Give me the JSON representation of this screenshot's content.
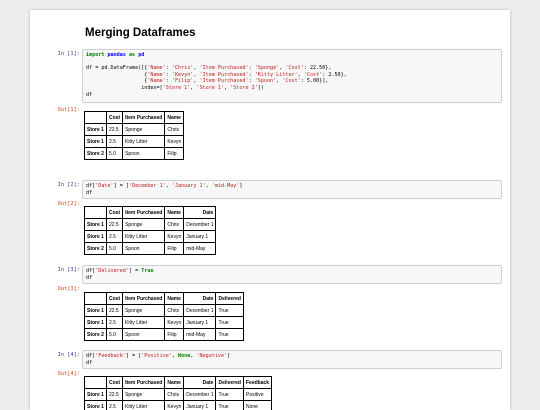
{
  "notebook": {
    "title": "Merging Dataframes",
    "cells": [
      {
        "in_prompt": "In [1]:",
        "out_prompt": "Out[1]:",
        "code_lines": [
          [
            {
              "t": "import",
              "c": "kw"
            },
            {
              "t": " "
            },
            {
              "t": "pandas",
              "c": "nm"
            },
            {
              "t": " "
            },
            {
              "t": "as",
              "c": "kw"
            },
            {
              "t": " "
            },
            {
              "t": "pd",
              "c": "nm"
            }
          ],
          [
            {
              "t": ""
            }
          ],
          [
            {
              "t": "df = pd.DataFrame([{"
            },
            {
              "t": "'Name'",
              "c": "str"
            },
            {
              "t": ": "
            },
            {
              "t": "'Chris'",
              "c": "str"
            },
            {
              "t": ", "
            },
            {
              "t": "'Item Purchased'",
              "c": "str"
            },
            {
              "t": ": "
            },
            {
              "t": "'Sponge'",
              "c": "str"
            },
            {
              "t": ", "
            },
            {
              "t": "'Cost'",
              "c": "str"
            },
            {
              "t": ": 22.50},"
            }
          ],
          [
            {
              "t": "                   {"
            },
            {
              "t": "'Name'",
              "c": "str"
            },
            {
              "t": ": "
            },
            {
              "t": "'Kevyn'",
              "c": "str"
            },
            {
              "t": ", "
            },
            {
              "t": "'Item Purchased'",
              "c": "str"
            },
            {
              "t": ": "
            },
            {
              "t": "'Kitty Litter'",
              "c": "str"
            },
            {
              "t": ", "
            },
            {
              "t": "'Cost'",
              "c": "str"
            },
            {
              "t": ": 2.50},"
            }
          ],
          [
            {
              "t": "                   {"
            },
            {
              "t": "'Name'",
              "c": "str"
            },
            {
              "t": ": "
            },
            {
              "t": "'Filip'",
              "c": "str"
            },
            {
              "t": ", "
            },
            {
              "t": "'Item Purchased'",
              "c": "str"
            },
            {
              "t": ": "
            },
            {
              "t": "'Spoon'",
              "c": "str"
            },
            {
              "t": ", "
            },
            {
              "t": "'Cost'",
              "c": "str"
            },
            {
              "t": ": 5.00}],"
            }
          ],
          [
            {
              "t": "                  index=["
            },
            {
              "t": "'Store 1'",
              "c": "str"
            },
            {
              "t": ", "
            },
            {
              "t": "'Store 1'",
              "c": "str"
            },
            {
              "t": ", "
            },
            {
              "t": "'Store 2'",
              "c": "str"
            },
            {
              "t": "])"
            }
          ],
          [
            {
              "t": "df"
            }
          ]
        ],
        "columns": [
          "Cost",
          "Item Purchased",
          "Name"
        ],
        "right_cols": [],
        "rows": [
          {
            "index": "Store 1",
            "values": [
              "22.5",
              "Sponge",
              "Chris"
            ]
          },
          {
            "index": "Store 1",
            "values": [
              "2.5",
              "Kitty Litter",
              "Kevyn"
            ]
          },
          {
            "index": "Store 2",
            "values": [
              "5.0",
              "Spoon",
              "Filip"
            ]
          }
        ]
      },
      {
        "in_prompt": "In [2]:",
        "out_prompt": "Out[2]:",
        "code_lines": [
          [
            {
              "t": "df["
            },
            {
              "t": "'Date'",
              "c": "str"
            },
            {
              "t": "] = ["
            },
            {
              "t": "'December 1'",
              "c": "str"
            },
            {
              "t": ", "
            },
            {
              "t": "'January 1'",
              "c": "str"
            },
            {
              "t": ", "
            },
            {
              "t": "'mid-May'",
              "c": "str"
            },
            {
              "t": "]"
            }
          ],
          [
            {
              "t": "df"
            }
          ]
        ],
        "columns": [
          "Cost",
          "Item Purchased",
          "Name",
          "Date"
        ],
        "right_cols": [
          3
        ],
        "rows": [
          {
            "index": "Store 1",
            "values": [
              "22.5",
              "Sponge",
              "Chris",
              "December 1"
            ]
          },
          {
            "index": "Store 1",
            "values": [
              "2.5",
              "Kitty Litter",
              "Kevyn",
              "January 1"
            ]
          },
          {
            "index": "Store 2",
            "values": [
              "5.0",
              "Spoon",
              "Filip",
              "mid-May"
            ]
          }
        ]
      },
      {
        "in_prompt": "In [3]:",
        "out_prompt": "Out[3]:",
        "code_lines": [
          [
            {
              "t": "df["
            },
            {
              "t": "'Delivered'",
              "c": "str"
            },
            {
              "t": "] = "
            },
            {
              "t": "True",
              "c": "kw"
            }
          ],
          [
            {
              "t": "df"
            }
          ]
        ],
        "columns": [
          "Cost",
          "Item Purchased",
          "Name",
          "Date",
          "Delivered"
        ],
        "right_cols": [
          3
        ],
        "rows": [
          {
            "index": "Store 1",
            "values": [
              "22.5",
              "Sponge",
              "Chris",
              "December 1",
              "True"
            ]
          },
          {
            "index": "Store 1",
            "values": [
              "2.5",
              "Kitty Litter",
              "Kevyn",
              "January 1",
              "True"
            ]
          },
          {
            "index": "Store 2",
            "values": [
              "5.0",
              "Spoon",
              "Filip",
              "mid-May",
              "True"
            ]
          }
        ]
      },
      {
        "in_prompt": "In [4]:",
        "out_prompt": "Out[4]:",
        "code_lines": [
          [
            {
              "t": "df["
            },
            {
              "t": "'Feedback'",
              "c": "str"
            },
            {
              "t": "] = ["
            },
            {
              "t": "'Positive'",
              "c": "str"
            },
            {
              "t": ", "
            },
            {
              "t": "None",
              "c": "kw"
            },
            {
              "t": ", "
            },
            {
              "t": "'Negative'",
              "c": "str"
            },
            {
              "t": "]"
            }
          ],
          [
            {
              "t": "df"
            }
          ]
        ],
        "columns": [
          "Cost",
          "Item Purchased",
          "Name",
          "Date",
          "Delivered",
          "Feedback"
        ],
        "right_cols": [
          3
        ],
        "rows": [
          {
            "index": "Store 1",
            "values": [
              "22.5",
              "Sponge",
              "Chris",
              "December 1",
              "True",
              "Positive"
            ]
          },
          {
            "index": "Store 1",
            "values": [
              "2.5",
              "Kitty Litter",
              "Kevyn",
              "January 1",
              "True",
              "None"
            ]
          }
        ]
      }
    ]
  }
}
